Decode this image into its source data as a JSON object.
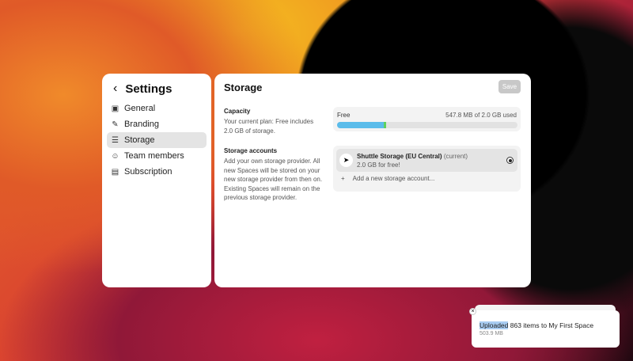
{
  "sidebar": {
    "title": "Settings",
    "items": [
      {
        "label": "General",
        "icon": "building-icon"
      },
      {
        "label": "Branding",
        "icon": "brush-icon"
      },
      {
        "label": "Storage",
        "icon": "storage-icon",
        "active": true
      },
      {
        "label": "Team members",
        "icon": "user-icon"
      },
      {
        "label": "Subscription",
        "icon": "card-icon"
      }
    ]
  },
  "main": {
    "title": "Storage",
    "save_label": "Save",
    "capacity": {
      "label": "Capacity",
      "desc": "Your current plan: Free includes 2.0 GB of storage.",
      "plan": "Free",
      "usage": "547.8 MB of 2.0 GB used",
      "used_percent": 26,
      "extra_percent": 1,
      "bar_color": "#5bbcea",
      "extra_color": "#5ed15e"
    },
    "accounts": {
      "label": "Storage accounts",
      "desc": "Add your own storage provider. All new Spaces will be stored on your new storage provider from then on. Existing Spaces will remain on the previous storage provider.",
      "current": {
        "name": "Shuttle Storage (EU Central)",
        "tag": "(current)",
        "sub": "2.0 GB for free!"
      },
      "add_label": "Add a new storage account...",
      "add_icon": "+"
    }
  },
  "toast": {
    "highlight": "Uploaded",
    "message": " 863 items to My First Space",
    "size": "503.9 MB",
    "close": "×"
  }
}
